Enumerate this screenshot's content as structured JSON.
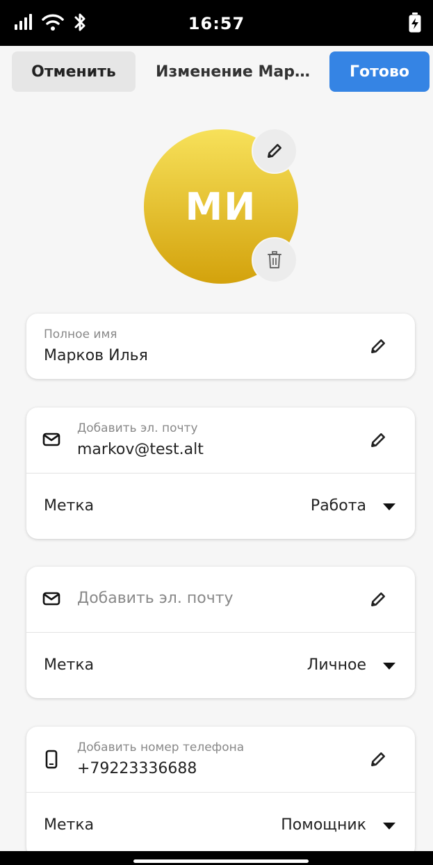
{
  "status_bar": {
    "time": "16:57",
    "icons": [
      "signal-icon",
      "wifi-icon",
      "bluetooth-icon",
      "battery-charging-icon"
    ]
  },
  "header": {
    "cancel_label": "Отменить",
    "title": "Изменение Мар…",
    "done_label": "Готово"
  },
  "avatar": {
    "initials": "МИ",
    "colors": {
      "top": "#f7e15a",
      "bottom": "#d3a20c"
    },
    "edit_icon": "pencil-icon",
    "delete_icon": "trash-icon"
  },
  "full_name": {
    "caption": "Полное имя",
    "value": "Марков Илья"
  },
  "emails": [
    {
      "icon": "envelope-icon",
      "caption": "Добавить эл. почту",
      "value": "markov@test.alt",
      "label_caption": "Метка",
      "label_value": "Работа"
    },
    {
      "icon": "envelope-icon",
      "placeholder": "Добавить эл. почту",
      "label_caption": "Метка",
      "label_value": "Личное"
    }
  ],
  "phone": {
    "icon": "phone-icon",
    "caption": "Добавить номер телефона",
    "value": "+79223336688",
    "label_caption": "Метка",
    "label_value": "Помощник"
  },
  "colors": {
    "accent": "#3584e4",
    "background": "#f6f6f6",
    "cancel_bg": "#e6e6e6"
  }
}
